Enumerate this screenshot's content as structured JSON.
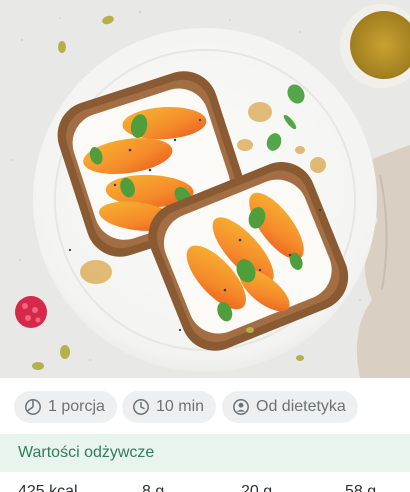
{
  "photo": {
    "alt_name": "peach-toast-photo"
  },
  "chips": [
    {
      "icon": "portion-icon",
      "label": "1 porcja"
    },
    {
      "icon": "clock-icon",
      "label": "10 min"
    },
    {
      "icon": "user-icon",
      "label": "Od dietetyka"
    }
  ],
  "nutrition": {
    "title": "Wartości odżywcze",
    "values": [
      "425 kcal",
      "8 g",
      "20 g",
      "58 g"
    ]
  },
  "colors": {
    "chip_bg": "#edeff1",
    "chip_text": "#6b7378",
    "section_bg": "#eaf4ef",
    "section_text": "#2f7d5a"
  }
}
